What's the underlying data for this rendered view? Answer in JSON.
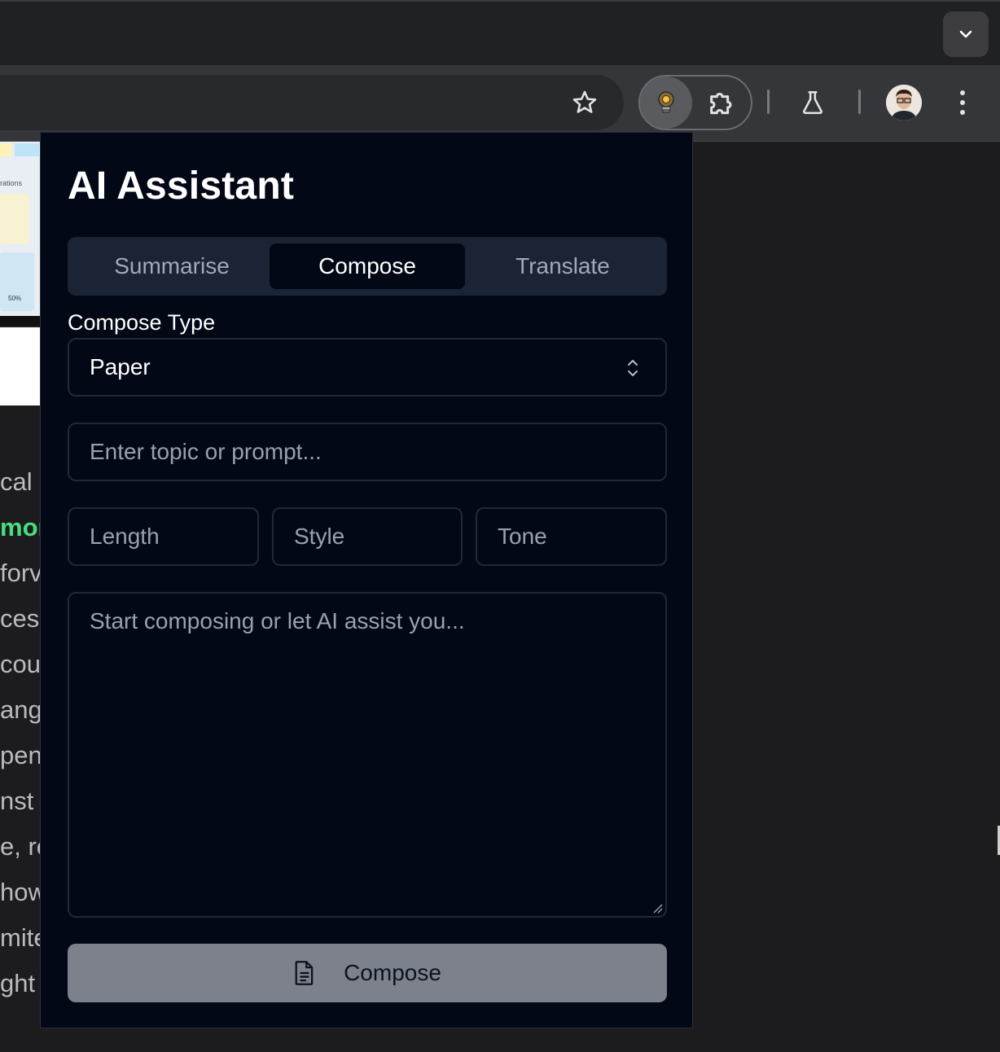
{
  "browser": {
    "tab_search_icon": "chevron-down-icon",
    "star_icon": "star-icon",
    "extensions": [
      "lightbulb-icon",
      "puzzle-icon",
      "flask-icon"
    ],
    "menu_icon": "kebab-icon"
  },
  "background_page": {
    "thumb_label": "rations",
    "thumb_percent": "50%",
    "text_fragments": [
      "cal",
      "mor",
      "forv",
      "ces",
      "coul",
      "angu",
      "pen",
      "nst",
      "e, re",
      "how",
      "mite",
      "ght"
    ]
  },
  "popup": {
    "title": "AI Assistant",
    "tabs": [
      {
        "label": "Summarise",
        "active": false
      },
      {
        "label": "Compose",
        "active": true
      },
      {
        "label": "Translate",
        "active": false
      }
    ],
    "compose_type_label": "Compose Type",
    "compose_type_value": "Paper",
    "prompt_placeholder": "Enter topic or prompt...",
    "length_placeholder": "Length",
    "style_placeholder": "Style",
    "tone_placeholder": "Tone",
    "editor_placeholder": "Start composing or let AI assist you...",
    "compose_button_label": "Compose",
    "compose_button_icon": "document-icon"
  },
  "colors": {
    "popup_bg": "#030816",
    "tab_strip_bg": "#1b2434",
    "button_bg": "#7d818b",
    "accent_green": "#4ade80"
  }
}
